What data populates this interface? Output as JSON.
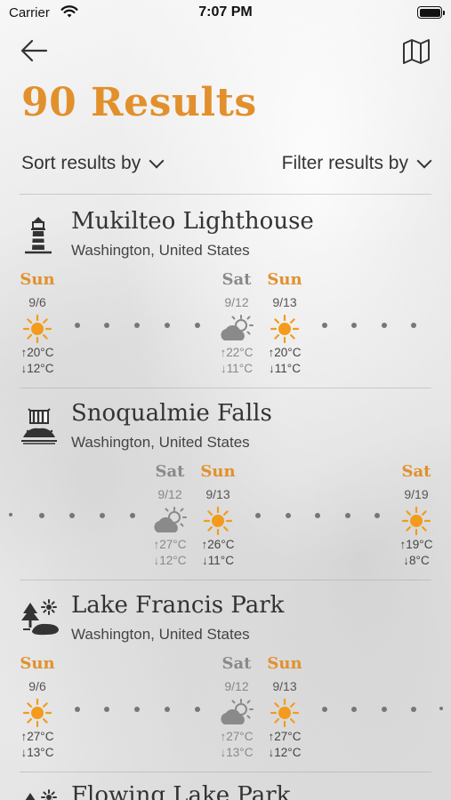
{
  "status": {
    "carrier": "Carrier",
    "time": "7:07 PM"
  },
  "header": {
    "title": "90 Results"
  },
  "controls": {
    "sort_label": "Sort results by",
    "filter_label": "Filter results by"
  },
  "results": [
    {
      "name": "Mukilteo Lighthouse",
      "region": "Washington, United States",
      "icon": "lighthouse-icon",
      "days": [
        {
          "name": "Sun",
          "date": "9/6",
          "weather": "sun",
          "high": "↑20°C",
          "low": "↓12°C"
        },
        {
          "name": "Sat",
          "date": "9/12",
          "weather": "partly-cloudy",
          "high": "↑22°C",
          "low": "↓11°C"
        },
        {
          "name": "Sun",
          "date": "9/13",
          "weather": "sun",
          "high": "↑20°C",
          "low": "↓11°C"
        }
      ]
    },
    {
      "name": "Snoqualmie Falls",
      "region": "Washington, United States",
      "icon": "waterfall-icon",
      "days": [
        {
          "name": "Sat",
          "date": "9/12",
          "weather": "partly-cloudy",
          "high": "↑27°C",
          "low": "↓12°C"
        },
        {
          "name": "Sun",
          "date": "9/13",
          "weather": "sun",
          "high": "↑26°C",
          "low": "↓11°C"
        },
        {
          "name": "Sat",
          "date": "9/19",
          "weather": "sun",
          "high": "↑19°C",
          "low": "↓8°C"
        }
      ]
    },
    {
      "name": "Lake Francis Park",
      "region": "Washington, United States",
      "icon": "park-icon",
      "days": [
        {
          "name": "Sun",
          "date": "9/6",
          "weather": "sun",
          "high": "↑27°C",
          "low": "↓13°C"
        },
        {
          "name": "Sat",
          "date": "9/12",
          "weather": "partly-cloudy",
          "high": "↑27°C",
          "low": "↓13°C"
        },
        {
          "name": "Sun",
          "date": "9/13",
          "weather": "sun",
          "high": "↑27°C",
          "low": "↓12°C"
        }
      ]
    },
    {
      "name": "Flowing Lake Park",
      "region": "",
      "icon": "park-icon",
      "days": []
    }
  ],
  "colors": {
    "accent": "#e2902c",
    "weekend_sat": "#8a8a8a",
    "text": "#333333"
  }
}
